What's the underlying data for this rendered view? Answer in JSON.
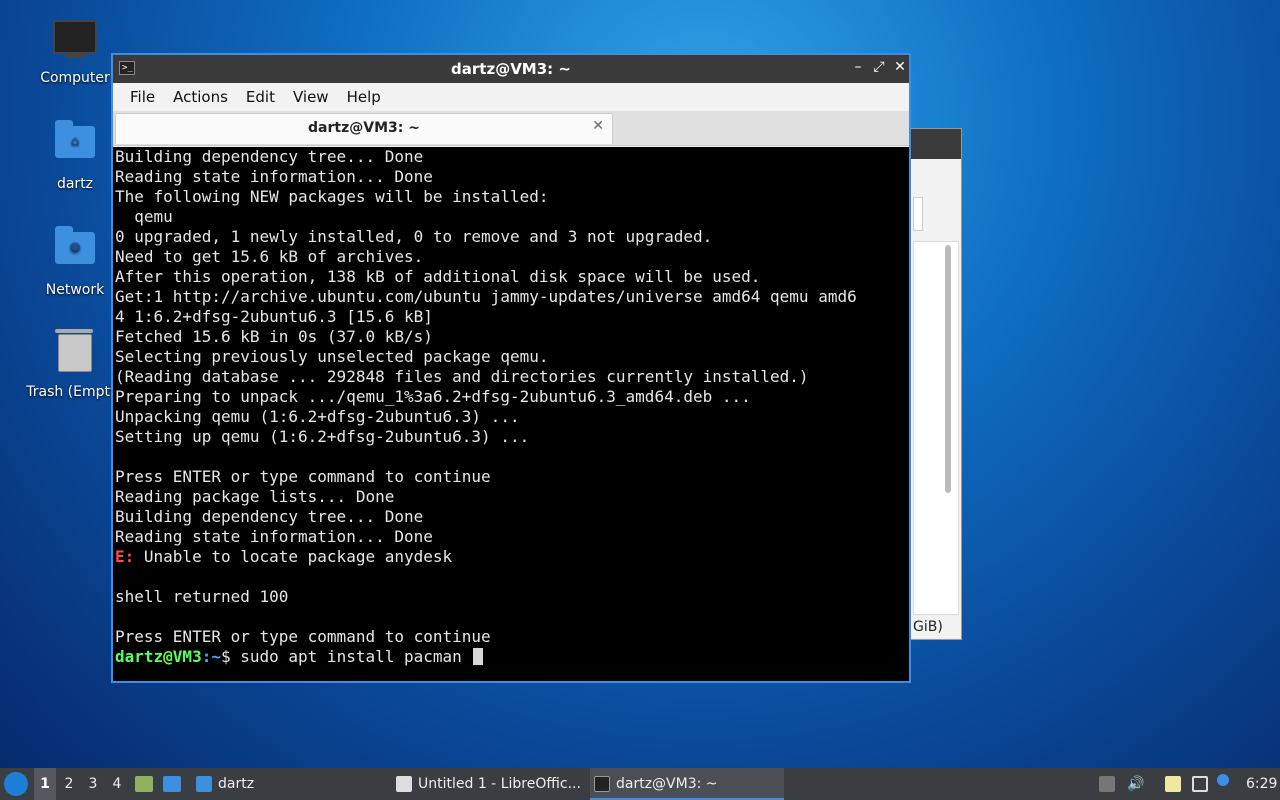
{
  "desktop": {
    "icons": [
      {
        "label": "Computer",
        "icon": "computer-icon"
      },
      {
        "label": "dartz",
        "icon": "home-folder-icon"
      },
      {
        "label": "Network",
        "icon": "network-folder-icon"
      },
      {
        "label": "Trash (Empty)",
        "icon": "trash-icon"
      }
    ]
  },
  "background_window": {
    "partial_text": "GiB)"
  },
  "terminal": {
    "window_title": "dartz@VM3: ~",
    "menu": [
      "File",
      "Actions",
      "Edit",
      "View",
      "Help"
    ],
    "tab_title": "dartz@VM3: ~",
    "lines": [
      "Building dependency tree... Done",
      "Reading state information... Done",
      "The following NEW packages will be installed:",
      "  qemu",
      "0 upgraded, 1 newly installed, 0 to remove and 3 not upgraded.",
      "Need to get 15.6 kB of archives.",
      "After this operation, 138 kB of additional disk space will be used.",
      "Get:1 http://archive.ubuntu.com/ubuntu jammy-updates/universe amd64 qemu amd6",
      "4 1:6.2+dfsg-2ubuntu6.3 [15.6 kB]",
      "Fetched 15.6 kB in 0s (37.0 kB/s)",
      "Selecting previously unselected package qemu.",
      "(Reading database ... 292848 files and directories currently installed.)",
      "Preparing to unpack .../qemu_1%3a6.2+dfsg-2ubuntu6.3_amd64.deb ...",
      "Unpacking qemu (1:6.2+dfsg-2ubuntu6.3) ...",
      "Setting up qemu (1:6.2+dfsg-2ubuntu6.3) ...",
      "",
      "Press ENTER or type command to continue",
      "Reading package lists... Done",
      "Building dependency tree... Done",
      "Reading state information... Done"
    ],
    "error_prefix": "E:",
    "error_text": " Unable to locate package anydesk",
    "blank": "",
    "shell_returned": "shell returned 100",
    "press_enter": "Press ENTER or type command to continue",
    "prompt_user": "dartz@VM3",
    "prompt_path": ":~",
    "prompt_symbol": "$ ",
    "command": "sudo apt install pacman"
  },
  "taskbar": {
    "workspaces": [
      "1",
      "2",
      "3",
      "4"
    ],
    "active_workspace": "1",
    "tasks": [
      {
        "label": "dartz",
        "icon": "folder-icon"
      },
      {
        "label": "Untitled 1 - LibreOffic...",
        "icon": "document-icon"
      },
      {
        "label": "dartz@VM3: ~",
        "icon": "terminal-icon"
      }
    ],
    "clock": "6:29"
  }
}
